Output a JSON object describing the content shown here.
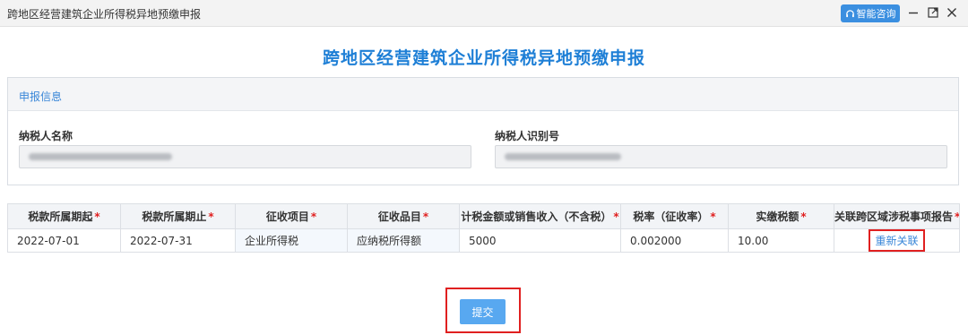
{
  "window": {
    "title": "跨地区经营建筑企业所得税异地预缴申报",
    "assist_label": "智能咨询"
  },
  "page": {
    "heading": "跨地区经营建筑企业所得税异地预缴申报"
  },
  "info_panel": {
    "title": "申报信息",
    "taxpayer_name_label": "纳税人名称",
    "taxpayer_id_label": "纳税人识别号"
  },
  "table": {
    "headers": [
      "税款所属期起",
      "税款所属期止",
      "征收项目",
      "征收品目",
      "计税金额或销售收入（不含税）",
      "税率（征收率）",
      "实缴税额",
      "关联跨区域涉税事项报告"
    ],
    "required_mark": "*",
    "row": {
      "period_start": "2022-07-01",
      "period_end": "2022-07-31",
      "collection_item": "企业所得税",
      "collection_subitem": "应纳税所得额",
      "taxable_amount": "5000",
      "tax_rate": "0.002000",
      "paid_tax": "10.00",
      "relink_label": "重新关联"
    }
  },
  "actions": {
    "submit_label": "提交"
  },
  "colors": {
    "accent": "#1e7fd6",
    "button": "#58a8f0",
    "required": "#e02020",
    "highlight_frame": "#e02020"
  }
}
